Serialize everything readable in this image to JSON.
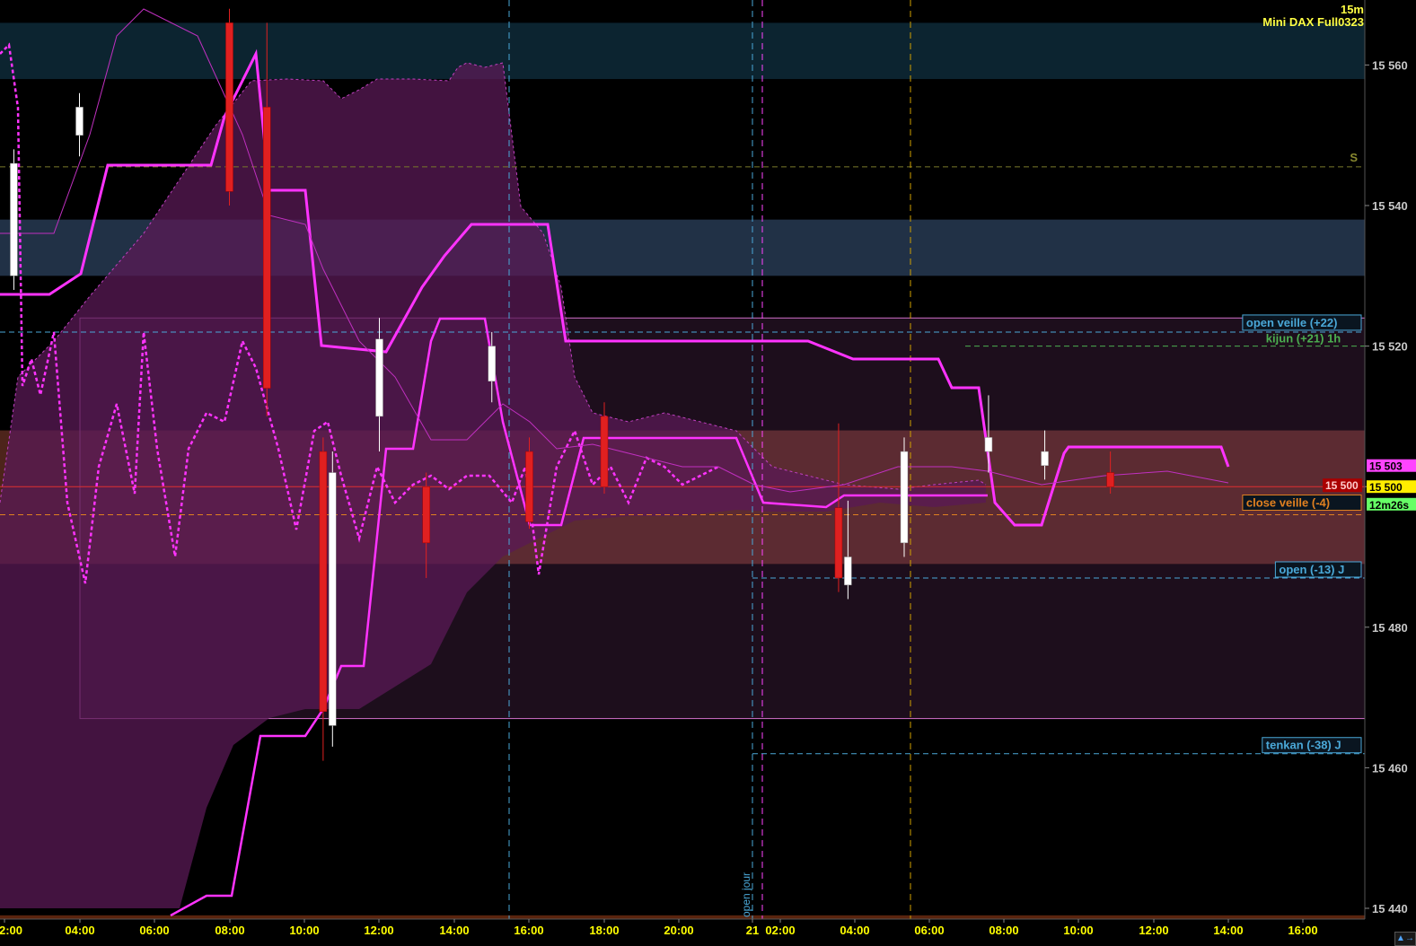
{
  "instrument": {
    "timeframe": "15m",
    "name": "Mini DAX Full0323"
  },
  "colors": {
    "background": "#000000",
    "up_candle": "#ffffff",
    "down_candle": "#e02020",
    "kumo": "#5a1a50",
    "kijun_tenkan": "#ff33ff",
    "axis_text": "#ffff00"
  },
  "scroll_button_icon": "scroll-right-icon",
  "chart_data": {
    "type": "candlestick",
    "title": "",
    "x_ticks": [
      "2:00",
      "04:00",
      "06:00",
      "08:00",
      "10:00",
      "12:00",
      "14:00",
      "16:00",
      "18:00",
      "20:00",
      "21",
      "02:00",
      "04:00",
      "06:00",
      "08:00",
      "10:00",
      "12:00",
      "14:00",
      "16:00"
    ],
    "y_ticks": [
      "15 560",
      "15 540",
      "15 520",
      "15 500",
      "15 480",
      "15 460",
      "15 440"
    ],
    "ylim": [
      15437,
      15566
    ],
    "grid": false,
    "price_tags": [
      {
        "text": "15 503",
        "value": 15503,
        "color": "#ff44ff"
      },
      {
        "text": "15 500",
        "value": 15500,
        "color": "#ffee00"
      },
      {
        "text": "12m26s",
        "value": 15497.5,
        "color": "#66ff66"
      }
    ],
    "current_price_label": {
      "text": "15 500",
      "value": 15500
    },
    "horizontal_levels": [
      {
        "label": "S",
        "value": 15545.5,
        "color": "#7a7a2a"
      },
      {
        "label": "open veille (+22)",
        "value": 15522,
        "color": "#4aa8d8"
      },
      {
        "label": "kijun (+21) 1h",
        "value": 15520,
        "color": "#4caf50"
      },
      {
        "label": "close veille (-4)",
        "value": 15496,
        "color": "#e08020"
      },
      {
        "label": "open (-13) J",
        "value": 15487,
        "color": "#4aa8d8"
      },
      {
        "label": "tenkan (-38) J",
        "value": 15462,
        "color": "#4aa8d8"
      }
    ],
    "vertical_markers": [
      {
        "label": "",
        "x": "15:30",
        "color": "#4aa8d8"
      },
      {
        "label": "open jour",
        "x": "00:00",
        "color": "#4aa8d8"
      },
      {
        "label": "",
        "x": "00:15",
        "color": "#ff44ff"
      },
      {
        "label": "",
        "x": "05:30",
        "color": "#d0a000"
      }
    ],
    "zones": [
      {
        "from": 15558,
        "to": 15566,
        "color": "#0e2a38"
      },
      {
        "from": 15530,
        "to": 15538,
        "color": "#273a52"
      },
      {
        "from": 15489,
        "to": 15508,
        "color": "#5a2a20"
      },
      {
        "from": 15437,
        "to": 15439,
        "color": "#6a2a10"
      }
    ],
    "candles_sample": [
      {
        "t": "02:15",
        "o": 15530,
        "h": 15548,
        "l": 15528,
        "c": 15546
      },
      {
        "t": "04:00",
        "o": 15550,
        "h": 15556,
        "l": 15547,
        "c": 15554
      },
      {
        "t": "08:00",
        "o": 15566,
        "h": 15568,
        "l": 15540,
        "c": 15542
      },
      {
        "t": "09:00",
        "o": 15554,
        "h": 15566,
        "l": 15510,
        "c": 15514
      },
      {
        "t": "10:30",
        "o": 15505,
        "h": 15507,
        "l": 15461,
        "c": 15468
      },
      {
        "t": "10:45",
        "o": 15466,
        "h": 15505,
        "l": 15463,
        "c": 15502
      },
      {
        "t": "12:00",
        "o": 15510,
        "h": 15524,
        "l": 15505,
        "c": 15521
      },
      {
        "t": "13:15",
        "o": 15500,
        "h": 15502,
        "l": 15487,
        "c": 15492
      },
      {
        "t": "15:00",
        "o": 15515,
        "h": 15522,
        "l": 15512,
        "c": 15520
      },
      {
        "t": "16:00",
        "o": 15505,
        "h": 15507,
        "l": 15494,
        "c": 15495
      },
      {
        "t": "18:00",
        "o": 15510,
        "h": 15512,
        "l": 15499,
        "c": 15500
      },
      {
        "t": "00:15",
        "o": 15497,
        "h": 15509,
        "l": 15485,
        "c": 15487
      },
      {
        "t": "00:30",
        "o": 15486,
        "h": 15498,
        "l": 15484,
        "c": 15490
      },
      {
        "t": "02:00",
        "o": 15492,
        "h": 15507,
        "l": 15490,
        "c": 15505
      },
      {
        "t": "04:15",
        "o": 15505,
        "h": 15513,
        "l": 15502,
        "c": 15507
      },
      {
        "t": "05:45",
        "o": 15503,
        "h": 15508,
        "l": 15501,
        "c": 15505
      },
      {
        "t": "07:30",
        "o": 15502,
        "h": 15505,
        "l": 15499,
        "c": 15500
      }
    ]
  }
}
